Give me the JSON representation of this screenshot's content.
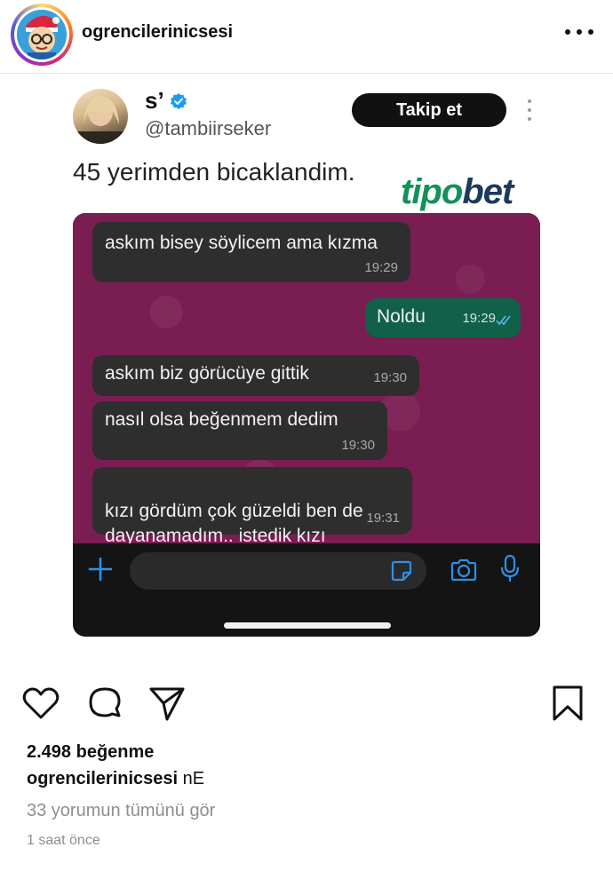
{
  "header": {
    "username": "ogrencilerinicsesi",
    "avatar_icon": "cartoon-avatar-icon",
    "more_icon": "more-horizontal-icon"
  },
  "tweet": {
    "display_name": "s’",
    "handle": "@tambiirseker",
    "follow_label": "Takip et",
    "text": "45 yerimden bicaklandim.",
    "verified_color": "#1d9bf0"
  },
  "watermark": {
    "part1": "tipo",
    "part2": "bet"
  },
  "chat": {
    "background_color": "#7a1d52",
    "messages": [
      {
        "text": "askım bisey söylicem ama kızma",
        "time": "19:29",
        "direction": "in"
      },
      {
        "text": "Noldu",
        "time": "19:29",
        "direction": "out"
      },
      {
        "text": "askım biz görücüye gittik",
        "time": "19:30",
        "direction": "in"
      },
      {
        "text": "nasıl olsa beğenmem dedim",
        "time": "19:30",
        "direction": "in"
      },
      {
        "text": "kızı gördüm çok güzeldi ben de\ndayanamadım.. istedik kızı",
        "time": "19:31",
        "direction": "in"
      }
    ]
  },
  "actions": {
    "like_icon": "heart-icon",
    "comment_icon": "comment-icon",
    "share_icon": "send-icon",
    "save_icon": "bookmark-icon"
  },
  "post": {
    "likes": "2.498 beğenme",
    "caption_user": "ogrencilerinicsesi",
    "caption_text": "nE",
    "comments_link": "33 yorumun tümünü gör",
    "time_ago": "1 saat önce"
  }
}
